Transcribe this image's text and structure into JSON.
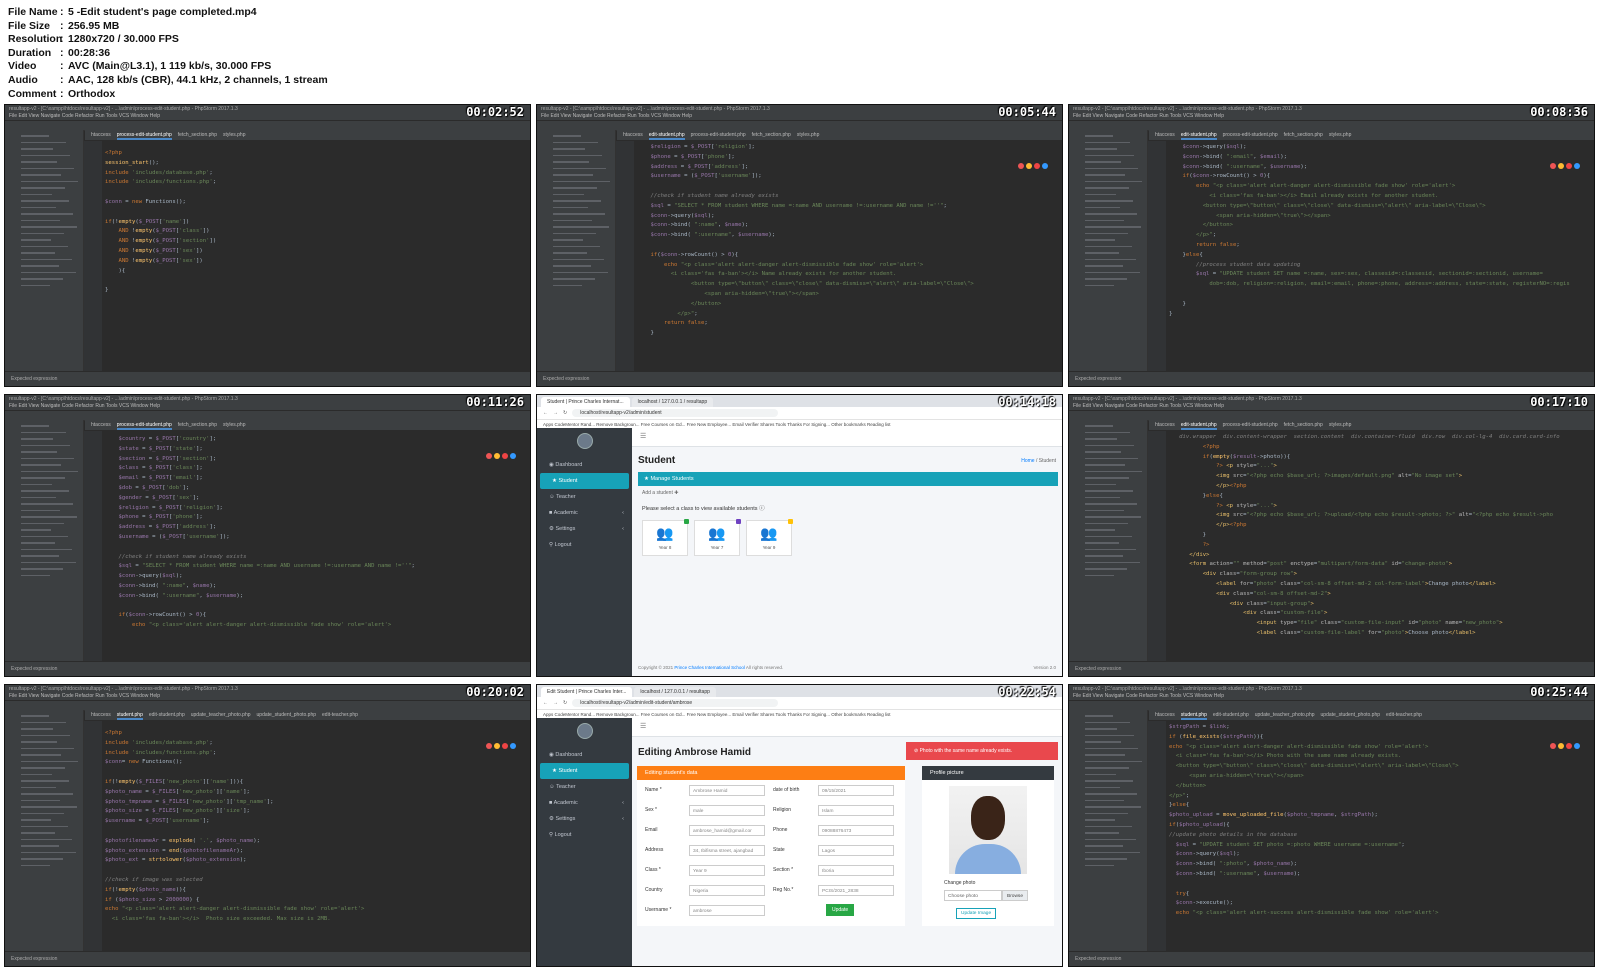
{
  "meta": [
    {
      "key": "File Name",
      "value": "5 -Edit student's page completed.mp4"
    },
    {
      "key": "File Size",
      "value": "256.95 MB"
    },
    {
      "key": "Resolution",
      "value": "1280x720 / 30.000 FPS"
    },
    {
      "key": "Duration",
      "value": "00:28:36"
    },
    {
      "key": "Video",
      "value": "AVC (Main@L3.1), 1 119 kb/s, 30.000 FPS"
    },
    {
      "key": "Audio",
      "value": "AAC, 128 kb/s (CBR), 44.1 kHz, 2 channels, 1 stream"
    },
    {
      "key": "Comment",
      "value": "Orthodox"
    }
  ],
  "tiles": [
    {
      "timestamp": "00:02:52"
    },
    {
      "timestamp": "00:05:44"
    },
    {
      "timestamp": "00:08:36"
    },
    {
      "timestamp": "00:11:26"
    },
    {
      "timestamp": "00:14:18"
    },
    {
      "timestamp": "00:17:10"
    },
    {
      "timestamp": "00:20:02"
    },
    {
      "timestamp": "00:22:54"
    },
    {
      "timestamp": "00:25:44"
    }
  ],
  "ide": {
    "title": "resultapp-v2 - [C:\\xampp\\htdocs\\resultapp-v2] - ...\\admin\\process-edit-student.php - PhpStorm 2017.1.3",
    "menu": "File  Edit  View  Navigate  Code  Refactor  Run  Tools  VCS  Window  Help",
    "status": "Expected expression",
    "tabs_a": [
      "htaccess",
      "process-edit-student.php",
      "fetch_section.php",
      "styles.php"
    ],
    "tabs_b": [
      "htaccess",
      "edit-student.php",
      "process-edit-student.php",
      "fetch_section.php",
      "styles.php"
    ],
    "tabs_c": [
      "htaccess",
      "student.php",
      "edit-student.php",
      "update_teacher_photo.php",
      "update_student_photo.php",
      "edit-teacher.php"
    ]
  },
  "browser1": {
    "tab": "Student | Prince Charles Internat...",
    "tab2": "localhost / 127.0.0.1 / resultapp",
    "url": "localhost/resultapp-v2/admin/student",
    "bookmarks": "Apps   CodeMentor Rand...   Remove Backgroun...   Free Courses on Gd...   Free New Employee...   Email Verifier   Shares Tools   Thanks For Signing...   Other bookmarks   Reading list",
    "nav": [
      "Dashboard",
      "Student",
      "Teacher",
      "Academic",
      "Settings",
      "Logout"
    ],
    "heading": "Student",
    "crumb_home": "Home",
    "crumb_cur": "Student",
    "manage": "Manage Students",
    "add": "Add a student",
    "hint": "Please select a class to view available students",
    "classes": [
      "Year 8",
      "Year 7",
      "Year 9"
    ],
    "class_colors": [
      "#28a745",
      "#6f42c1",
      "#ffc107"
    ],
    "copyright": "Copyright © 2021",
    "school": "Prince Charles International School",
    "rights": "All rights reserved.",
    "version": "Version 2.0"
  },
  "browser2": {
    "tab": "Edit Student | Prince Charles Inter...",
    "tab2": "localhost / 127.0.0.1 / resultapp",
    "url": "localhost/resultapp-v2/admin/edit-student/ambrose",
    "title": "Editing Ambrose Hamid",
    "alert": "Photo with the same name already exists.",
    "form_header": "Editing student's data",
    "fields": [
      {
        "l": "Name *",
        "v": "Ambrose Hamid",
        "l2": "date of birth",
        "v2": "09/15/2021"
      },
      {
        "l": "Sex *",
        "v": "male",
        "l2": "Religion",
        "v2": "Islam"
      },
      {
        "l": "Email",
        "v": "ambrose_hamid@gmail.cor",
        "l2": "Phone",
        "v2": "09088876473"
      },
      {
        "l": "Address",
        "v": "34, Ibifisma street, ajangbad",
        "l2": "State",
        "v2": "Lagos"
      },
      {
        "l": "Class *",
        "v": "Year 9",
        "l2": "Section *",
        "v2": "Iboria"
      },
      {
        "l": "Country",
        "v": "Nigeria",
        "l2": "Reg No.*",
        "v2": "PCIS/2021_2838"
      },
      {
        "l": "Username *",
        "v": "ambrose",
        "l2": "",
        "v2": ""
      }
    ],
    "update": "Update",
    "pic_header": "Profile picture",
    "change": "Change photo",
    "choose": "Choose photo",
    "browse": "Browse",
    "update_image": "Update Image"
  }
}
